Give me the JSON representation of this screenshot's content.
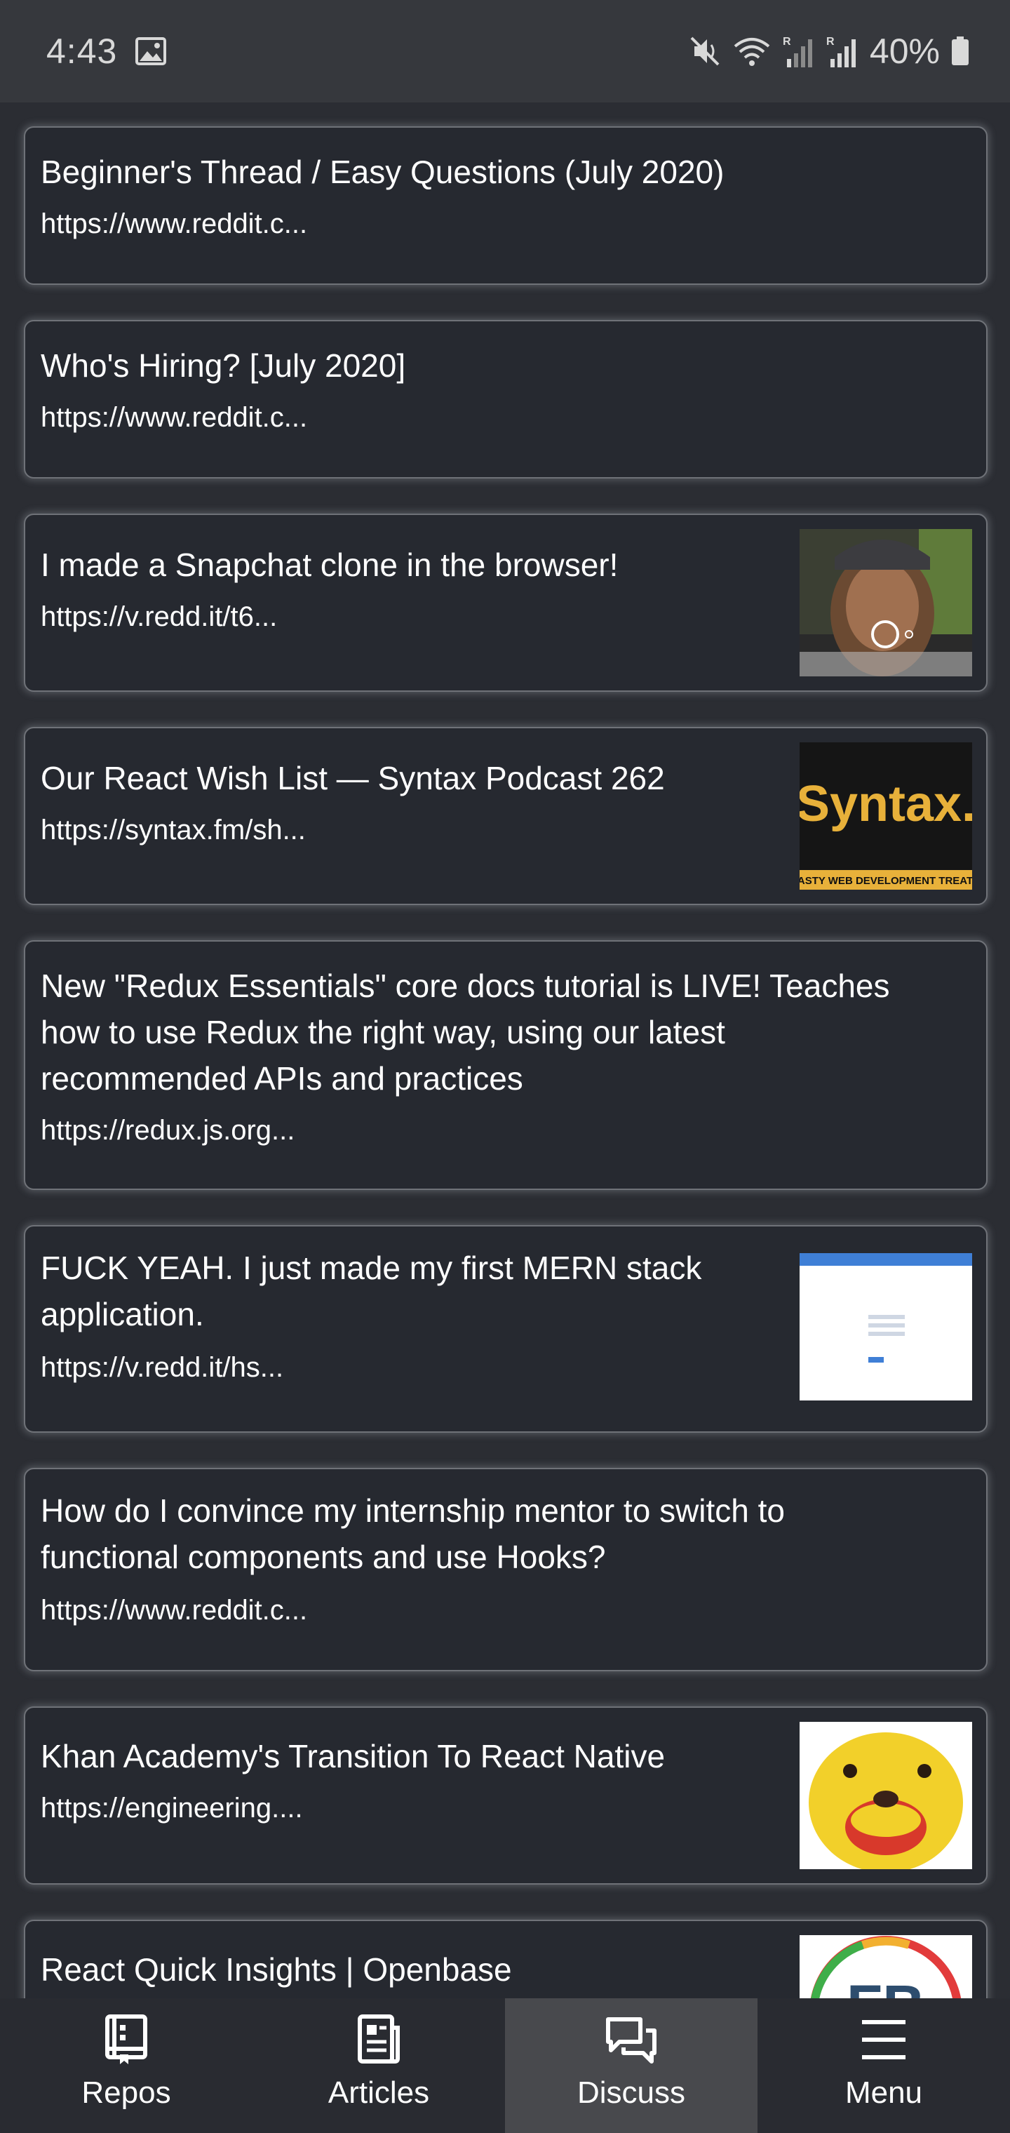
{
  "status_bar": {
    "time": "4:43",
    "battery": "40%"
  },
  "feed": {
    "items": [
      {
        "title": "Beginner's Thread / Easy Questions (July 2020)",
        "url": "https://www.reddit.c..."
      },
      {
        "title": "Who's Hiring? [July 2020]",
        "url": "https://www.reddit.c..."
      },
      {
        "title": "I made a Snapchat clone in the browser!",
        "url": "https://v.redd.it/t6..."
      },
      {
        "title": "Our React Wish List — Syntax Podcast 262",
        "url": "https://syntax.fm/sh...",
        "thumbnail_text": "Syntax.",
        "thumbnail_subtext": "TASTY WEB DEVELOPMENT TREATS"
      },
      {
        "title_lines": [
          "New \"Redux Essentials\" core docs tutorial is LIVE! Teaches",
          "how to use Redux the right way, using our latest",
          "recommended APIs and practices"
        ],
        "url": "https://redux.js.org..."
      },
      {
        "title_lines": [
          "FUCK YEAH. I just made my first MERN stack",
          "application."
        ],
        "url": "https://v.redd.it/hs..."
      },
      {
        "title_lines": [
          "How do I convince my internship mentor to switch to",
          "functional components and use Hooks?"
        ],
        "url": "https://www.reddit.c..."
      },
      {
        "title": "Khan Academy's Transition To React Native",
        "url": "https://engineering...."
      },
      {
        "title": "React Quick Insights | Openbase",
        "thumbnail_text": "FB"
      }
    ]
  },
  "bottom_nav": {
    "items": [
      {
        "label": "Repos",
        "icon": "repo-icon"
      },
      {
        "label": "Articles",
        "icon": "articles-icon"
      },
      {
        "label": "Discuss",
        "icon": "discuss-icon",
        "active": true
      },
      {
        "label": "Menu",
        "icon": "menu-icon"
      }
    ]
  },
  "colors": {
    "background": "#2b2d33",
    "card": "#262930",
    "card_border": "#6f7278",
    "status_bar": "#36383d",
    "nav_active": "#48494d"
  }
}
